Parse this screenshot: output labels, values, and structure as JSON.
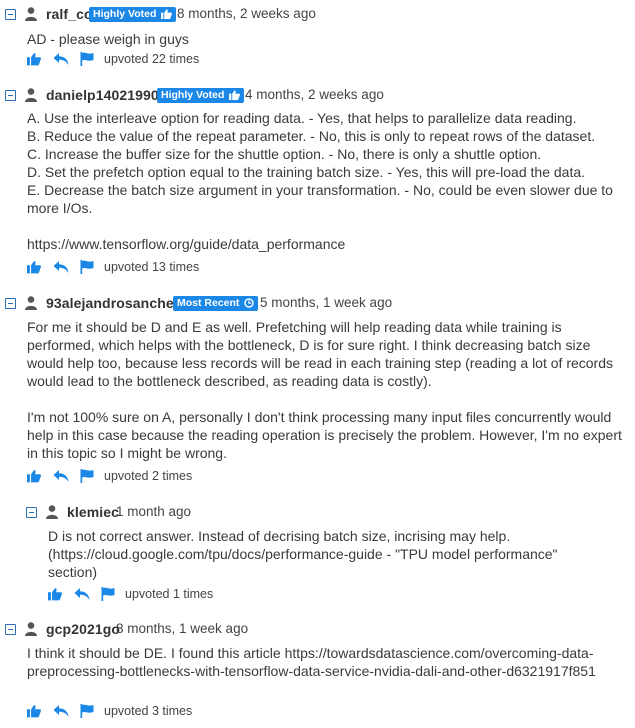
{
  "colors": {
    "accent": "#1b87e6",
    "text": "#3a3a3a"
  },
  "comments": [
    {
      "username": "ralf_cc",
      "badge": "Highly Voted",
      "date": "8 months, 2 weeks ago",
      "body": "AD - please weigh in guys",
      "upvotes": "upvoted 22 times"
    },
    {
      "username": "danielp14021990",
      "badge": "Highly Voted",
      "date": "4 months, 2 weeks ago",
      "body": "A. Use the interleave option for reading data. - Yes, that helps to parallelize data reading.\nB. Reduce the value of the repeat parameter. - No, this is only to repeat rows of the dataset.\nC. Increase the buffer size for the shuttle option. - No, there is only a shuttle option.\nD. Set the prefetch option equal to the training batch size. - Yes, this will pre-load the data.\nE. Decrease the batch size argument in your transformation. - No, could be even slower due to more I/Os.\n\nhttps://www.tensorflow.org/guide/data_performance",
      "upvotes": "upvoted 13 times"
    },
    {
      "username": "93alejandrosanchez",
      "badge": "Most Recent",
      "date": "5 months, 1 week ago",
      "body": "For me it should be D and E as well. Prefetching will help reading data while training is performed, which helps with the bottleneck, D is for sure right. I think decreasing batch size would help too, because less records will be read in each training step (reading a lot of records would lead to the bottleneck described, as reading data is costly).\n\nI'm not 100% sure on A, personally I don't think processing many input files concurrently would help in this case because the reading operation is precisely the problem. However, I'm no expert in this topic so I might be wrong.",
      "upvotes": "upvoted 2 times"
    },
    {
      "username": "klemiec",
      "date": "1 month ago",
      "body": "D is not correct answer. Instead of decrising batch size, incrising may help.\n(https://cloud.google.com/tpu/docs/performance-guide - \"TPU model performance\"\nsection)",
      "upvotes": "upvoted 1 times"
    },
    {
      "username": "gcp2021go",
      "date": "8 months, 1 week ago",
      "body": "I think it should be DE. I found this article https://towardsdatascience.com/overcoming-data-preprocessing-bottlenecks-with-tensorflow-data-service-nvidia-dali-and-other-d6321917f851",
      "upvotes": "upvoted 3 times"
    }
  ]
}
